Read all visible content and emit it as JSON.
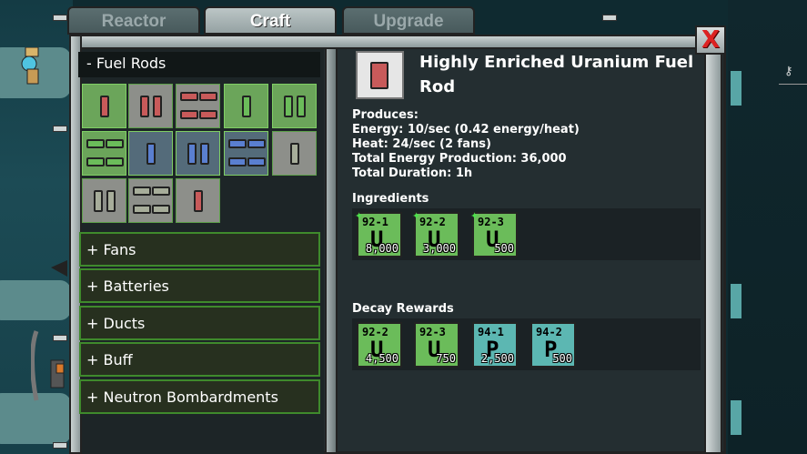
{
  "tabs": [
    "Reactor",
    "Craft",
    "Upgrade"
  ],
  "active_tab": "Craft",
  "close_label": "X",
  "categories": {
    "open": "- Fuel Rods",
    "collapsed": [
      "+ Fans",
      "+ Batteries",
      "+ Ducts",
      "+ Buff",
      "+ Neutron Bombardments"
    ]
  },
  "item": {
    "title": "Highly Enriched Uranium Fuel Rod",
    "produces_label": "Produces:",
    "energy": "Energy: 10/sec (0.42 energy/heat)",
    "heat": "Heat: 24/sec (2 fans)",
    "total_energy": "Total Energy Production: 36,000",
    "total_duration": "Total Duration: 1h"
  },
  "ingredients": {
    "title": "Ingredients",
    "items": [
      {
        "code": "92-1",
        "symbol": "U",
        "amount": "8,000",
        "icon": "uranium-tile"
      },
      {
        "code": "92-2",
        "symbol": "U",
        "amount": "3,000",
        "icon": "uranium-tile"
      },
      {
        "code": "92-3",
        "symbol": "U",
        "amount": "500",
        "icon": "uranium-tile"
      }
    ]
  },
  "decay_rewards": {
    "title": "Decay Rewards",
    "items": [
      {
        "code": "92-2",
        "symbol": "U",
        "amount": "4,500",
        "icon": "uranium-tile"
      },
      {
        "code": "92-3",
        "symbol": "U",
        "amount": "750",
        "icon": "uranium-tile"
      },
      {
        "code": "94-1",
        "symbol": "P",
        "amount": "2,500",
        "icon": "plutonium-tile"
      },
      {
        "code": "94-2",
        "symbol": "P",
        "amount": "500",
        "icon": "plutonium-tile"
      }
    ]
  },
  "colors": {
    "uranium": "#6bbc5a",
    "plutonium": "#5cb7b2",
    "selected_border": "#7fcf64",
    "close_x": "#dd2222"
  }
}
